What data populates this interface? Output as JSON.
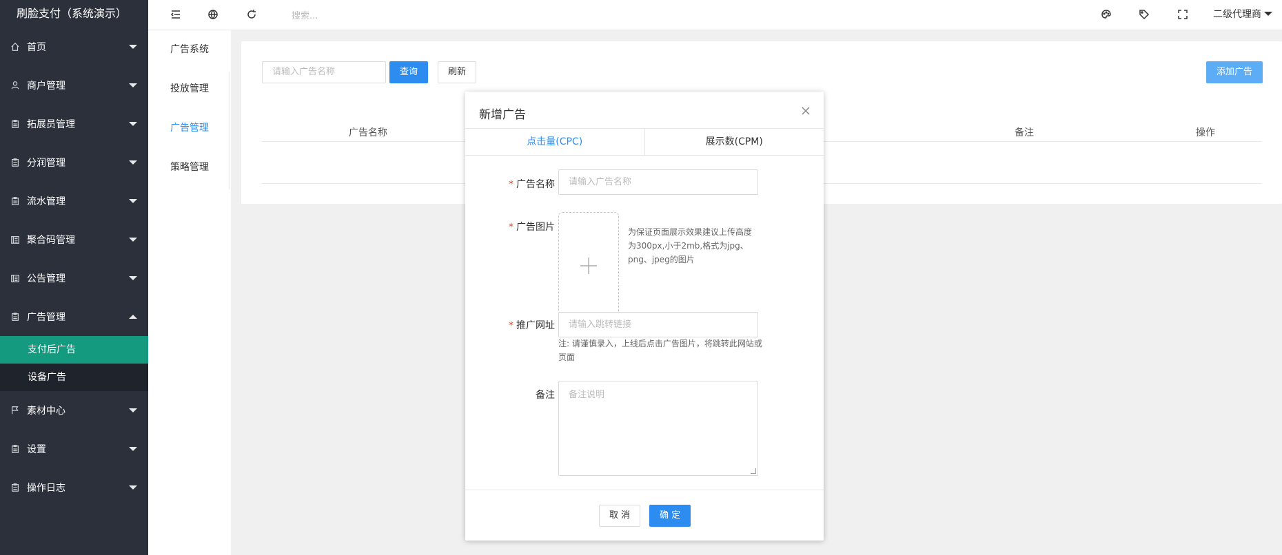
{
  "app": {
    "title": "刷脸支付（系统演示）"
  },
  "sidebar": {
    "items": [
      {
        "label": "首页",
        "icon": "home-icon"
      },
      {
        "label": "商户管理",
        "icon": "user-icon"
      },
      {
        "label": "拓展员管理",
        "icon": "clipboard-icon"
      },
      {
        "label": "分润管理",
        "icon": "clipboard-icon"
      },
      {
        "label": "流水管理",
        "icon": "clipboard-icon"
      },
      {
        "label": "聚合码管理",
        "icon": "list-icon"
      },
      {
        "label": "公告管理",
        "icon": "list-icon"
      },
      {
        "label": "广告管理",
        "icon": "clipboard-icon",
        "expanded": true
      },
      {
        "label": "素材中心",
        "icon": "flag-icon"
      },
      {
        "label": "设置",
        "icon": "clipboard-icon"
      },
      {
        "label": "操作日志",
        "icon": "clipboard-icon"
      }
    ],
    "sub_items": [
      {
        "label": "支付后广告",
        "active": true
      },
      {
        "label": "设备广告",
        "active": false
      }
    ],
    "active_color": "#139a7f"
  },
  "subnav": {
    "items": [
      {
        "label": "广告系统"
      },
      {
        "label": "投放管理"
      },
      {
        "label": "广告管理",
        "active": true
      },
      {
        "label": "策略管理"
      }
    ]
  },
  "header": {
    "search_placeholder": "搜索...",
    "user_role": "二级代理商"
  },
  "content": {
    "search_placeholder": "请输入广告名称",
    "query_label": "查询",
    "refresh_label": "刷新",
    "add_label": "添加广告",
    "columns": [
      "广告名称",
      "备注",
      "操作"
    ]
  },
  "modal": {
    "title": "新增广告",
    "tabs": [
      "点击量(CPC)",
      "展示数(CPM)"
    ],
    "fields": {
      "name_label": "广告名称",
      "name_placeholder": "请输入广告名称",
      "image_label": "广告图片",
      "image_hint": "为保证页面展示效果建议上传高度为300px,小于2mb,格式为jpg、png、jpeg的图片",
      "url_label": "推广网址",
      "url_placeholder": "请输入跳转链接",
      "url_note": "注: 请谨慎录入，上线后点击广告图片，将跳转此网站或页面",
      "remark_label": "备注",
      "remark_placeholder": "备注说明"
    },
    "cancel_label": "取 消",
    "ok_label": "确 定"
  },
  "colors": {
    "primary": "#2d8cf0",
    "sidebar_bg": "#2b303b",
    "active_green": "#139a7f"
  }
}
